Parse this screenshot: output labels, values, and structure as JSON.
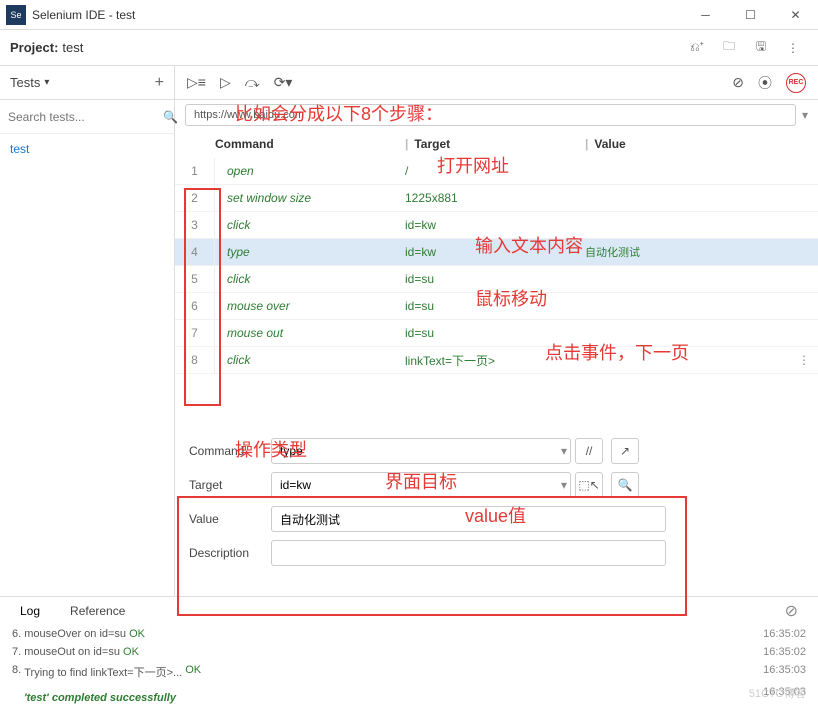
{
  "titlebar": {
    "icon": "Se",
    "text": "Selenium IDE - test"
  },
  "project": {
    "label": "Project:",
    "name": "test"
  },
  "sidebar": {
    "tests_label": "Tests",
    "search_placeholder": "Search tests...",
    "items": [
      "test"
    ]
  },
  "url": "https://www.baidu.com",
  "headers": {
    "command": "Command",
    "target": "Target",
    "value": "Value"
  },
  "rows": [
    {
      "n": "1",
      "cmd": "open",
      "tgt": "/",
      "val": ""
    },
    {
      "n": "2",
      "cmd": "set window size",
      "tgt": "1225x881",
      "val": ""
    },
    {
      "n": "3",
      "cmd": "click",
      "tgt": "id=kw",
      "val": ""
    },
    {
      "n": "4",
      "cmd": "type",
      "tgt": "id=kw",
      "val": "自动化测试"
    },
    {
      "n": "5",
      "cmd": "click",
      "tgt": "id=su",
      "val": ""
    },
    {
      "n": "6",
      "cmd": "mouse over",
      "tgt": "id=su",
      "val": ""
    },
    {
      "n": "7",
      "cmd": "mouse out",
      "tgt": "id=su",
      "val": ""
    },
    {
      "n": "8",
      "cmd": "click",
      "tgt": "linkText=下一页>",
      "val": ""
    }
  ],
  "form": {
    "command_label": "Command",
    "command_value": "type",
    "target_label": "Target",
    "target_value": "id=kw",
    "value_label": "Value",
    "value_value": "自动化测试",
    "description_label": "Description"
  },
  "annotations": {
    "a1": "比如会分成以下8个步骤：",
    "a2": "打开网址",
    "a3": "输入文本内容",
    "a4": "鼠标移动",
    "a5": "点击事件，下一页",
    "a6": "操作类型",
    "a7": "界面目标",
    "a8": "value值"
  },
  "log": {
    "tab_log": "Log",
    "tab_ref": "Reference",
    "lines": [
      {
        "n": "6.",
        "text": "mouseOver on id=su",
        "status": "OK",
        "time": "16:35:02"
      },
      {
        "n": "7.",
        "text": "mouseOut on id=su",
        "status": "OK",
        "time": "16:35:02"
      },
      {
        "n": "8.",
        "text": "Trying to find linkText=下一页>...",
        "status": "OK",
        "time": "16:35:03"
      }
    ],
    "success": "'test' completed successfully",
    "success_time": "16:35:03"
  },
  "watermark": "51CTO博客",
  "rec_label": "REC"
}
